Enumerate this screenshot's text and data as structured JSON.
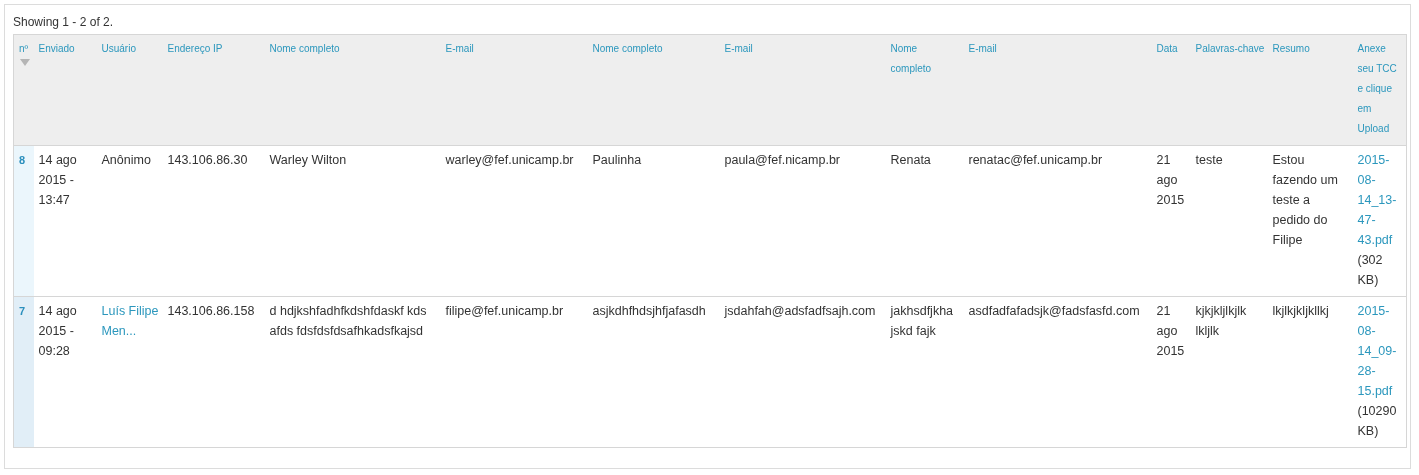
{
  "summary": "Showing 1 - 2 of 2.",
  "table": {
    "columns": [
      {
        "label": "nº",
        "sorted": true
      },
      {
        "label": "Enviado"
      },
      {
        "label": "Usuário"
      },
      {
        "label": "Endereço IP"
      },
      {
        "label": "Nome completo"
      },
      {
        "label": "E-mail"
      },
      {
        "label": "Nome completo"
      },
      {
        "label": "E-mail"
      },
      {
        "label": "Nome completo"
      },
      {
        "label": "E-mail"
      },
      {
        "label": "Data"
      },
      {
        "label": "Palavras-chave"
      },
      {
        "label": "Resumo"
      },
      {
        "label": "Anexe seu TCC e clique em Upload"
      }
    ],
    "rows": [
      {
        "cells": [
          {
            "kind": "number",
            "text": "8"
          },
          {
            "kind": "text",
            "text": "14 ago 2015 - 13:47"
          },
          {
            "kind": "text",
            "text": "Anônimo"
          },
          {
            "kind": "text",
            "text": "143.106.86.30"
          },
          {
            "kind": "text",
            "text": "Warley Wilton"
          },
          {
            "kind": "text",
            "text": "warley@fef.unicamp.br"
          },
          {
            "kind": "text",
            "text": "Paulinha"
          },
          {
            "kind": "text",
            "text": "paula@fef.nicamp.br"
          },
          {
            "kind": "text",
            "text": "Renata"
          },
          {
            "kind": "text",
            "text": "renatac@fef.unicamp.br"
          },
          {
            "kind": "text",
            "text": "21 ago 2015"
          },
          {
            "kind": "text",
            "text": "teste"
          },
          {
            "kind": "text",
            "text": "Estou fazendo um teste a pedido do Filipe"
          },
          {
            "kind": "file",
            "text": "2015-08-14_13-47-43.pdf",
            "size": "(302 KB)"
          }
        ]
      },
      {
        "cells": [
          {
            "kind": "number",
            "text": "7"
          },
          {
            "kind": "text",
            "text": "14 ago 2015 - 09:28"
          },
          {
            "kind": "link",
            "text": "Luís Filipe Men..."
          },
          {
            "kind": "text",
            "text": "143.106.86.158"
          },
          {
            "kind": "text",
            "text": "d hdjkshfadhfkdshfdaskf kds afds fdsfdsfdsafhkadsfkajsd"
          },
          {
            "kind": "text",
            "text": "filipe@fef.unicamp.br"
          },
          {
            "kind": "text",
            "text": "asjkdhfhdsjhfjafasdh"
          },
          {
            "kind": "text",
            "text": "jsdahfah@adsfadfsajh.com"
          },
          {
            "kind": "text",
            "text": "jakhsdfjkha jskd fajk"
          },
          {
            "kind": "text",
            "text": "asdfadfafadsjk@fadsfasfd.com"
          },
          {
            "kind": "text",
            "text": "21 ago 2015"
          },
          {
            "kind": "text",
            "text": "kjkjkljlkjlk lkljlk"
          },
          {
            "kind": "text",
            "text": "lkjlkjkljkllkj"
          },
          {
            "kind": "file",
            "text": "2015-08-14_09-28-15.pdf",
            "size": "(10290 KB)"
          }
        ]
      }
    ]
  }
}
